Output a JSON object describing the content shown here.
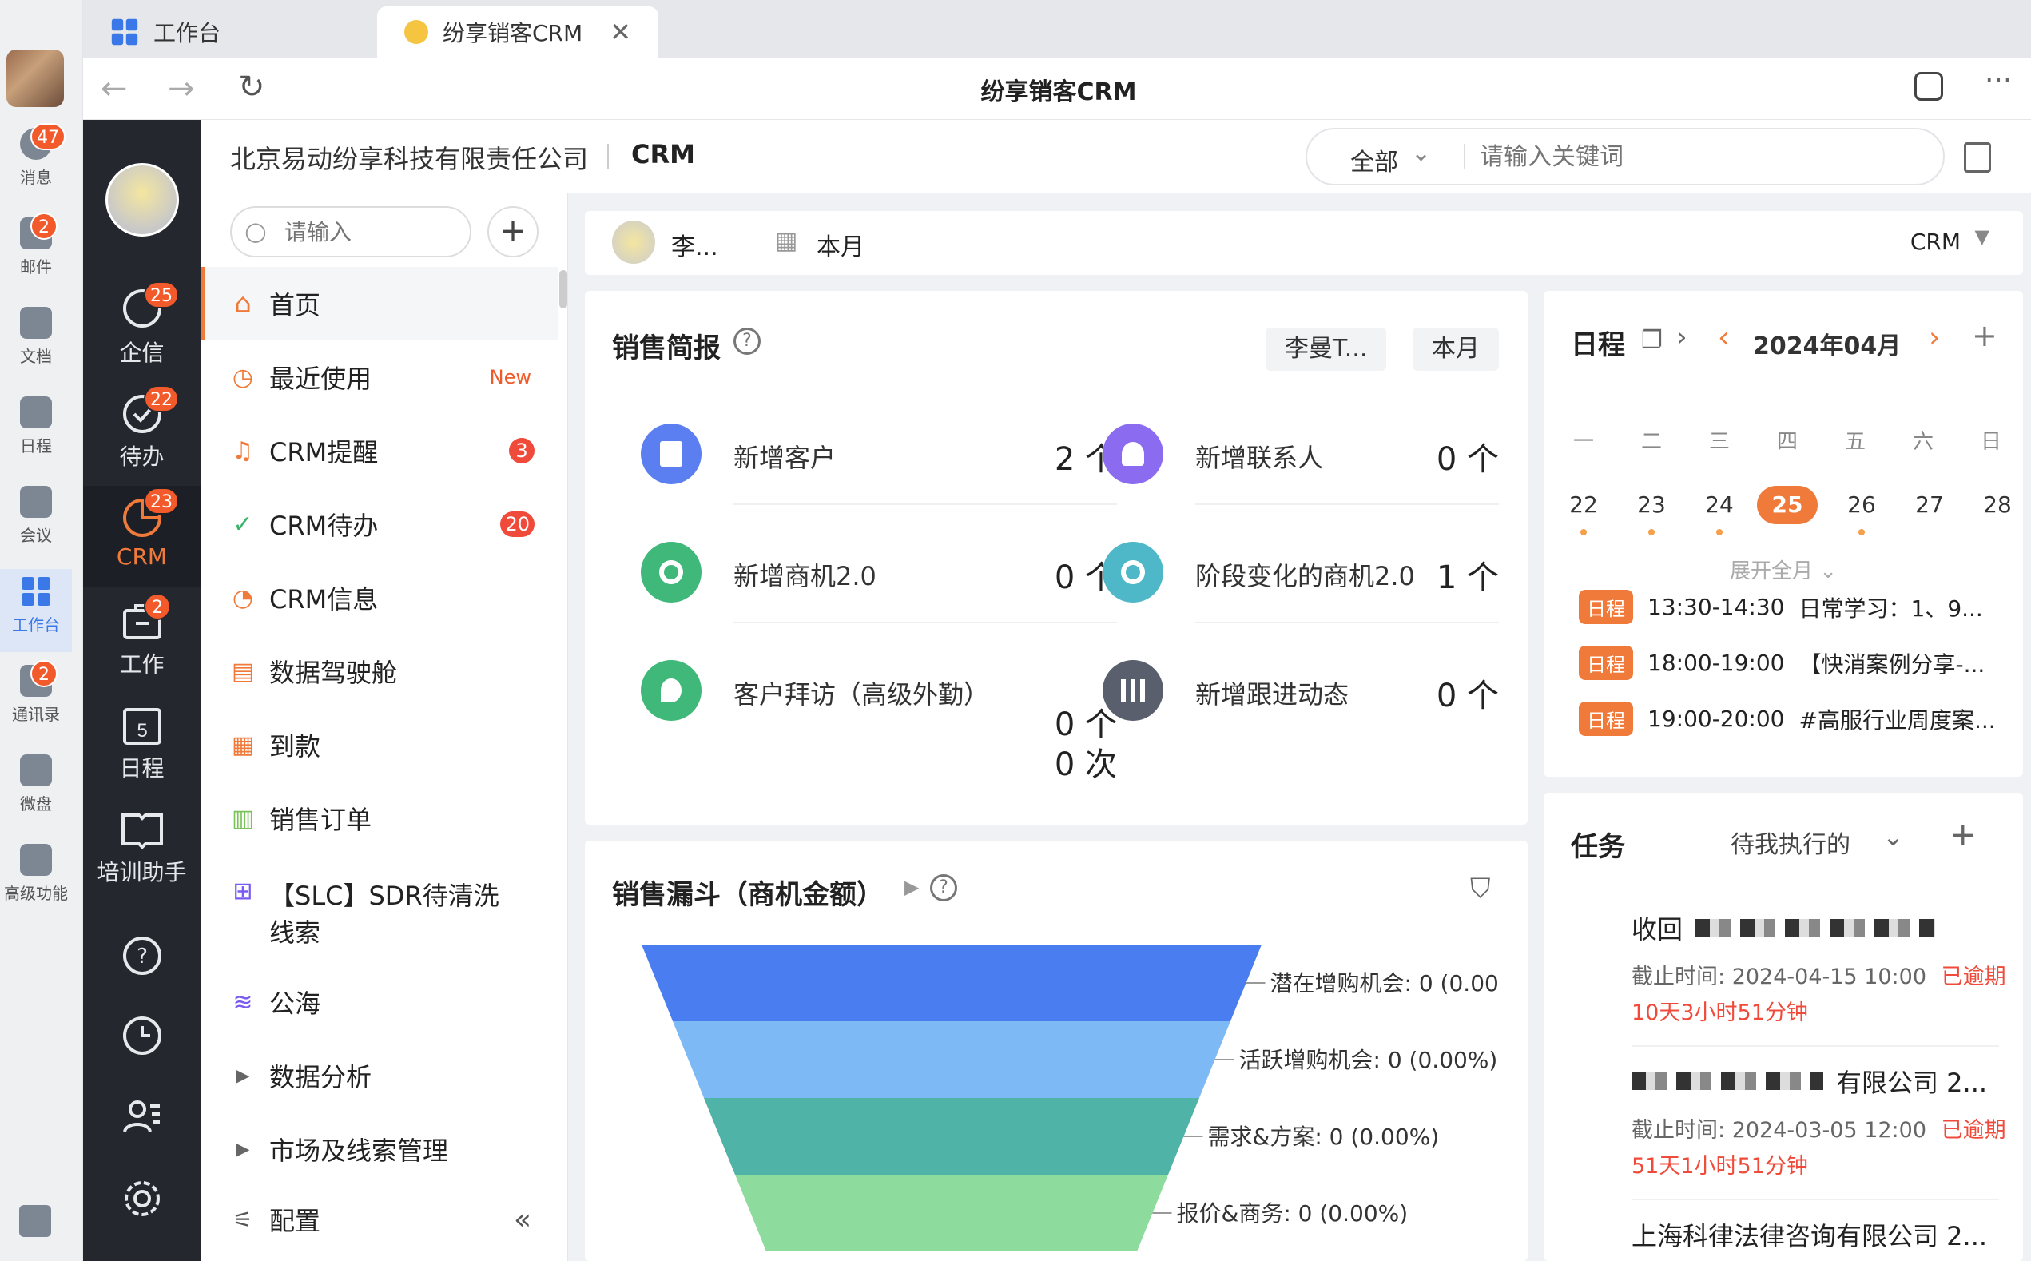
{
  "tabs": [
    {
      "label": "工作台",
      "active": false
    },
    {
      "label": "纷享销客CRM",
      "active": true
    }
  ],
  "window_title": "纷享销客CRM",
  "dock": [
    {
      "label": "消息",
      "badge": "47"
    },
    {
      "label": "邮件",
      "badge": "2"
    },
    {
      "label": "文档",
      "badge": ""
    },
    {
      "label": "日程",
      "badge": ""
    },
    {
      "label": "会议",
      "badge": ""
    },
    {
      "label": "工作台",
      "badge": ""
    },
    {
      "label": "通讯录",
      "badge": "2"
    },
    {
      "label": "微盘",
      "badge": ""
    },
    {
      "label": "高级功能",
      "badge": ""
    }
  ],
  "rail": [
    {
      "label": "企信",
      "badge": "25"
    },
    {
      "label": "待办",
      "badge": "22"
    },
    {
      "label": "CRM",
      "badge": "23"
    },
    {
      "label": "工作",
      "badge": "2"
    },
    {
      "label": "日程",
      "badge": "",
      "day": "5"
    },
    {
      "label": "培训助手",
      "badge": ""
    }
  ],
  "header": {
    "company": "北京易动纷享科技有限责任公司",
    "app": "CRM",
    "scope": "全部",
    "search_placeholder": "请输入关键词"
  },
  "menu": {
    "search_placeholder": "请输入",
    "items": [
      {
        "label": "首页",
        "badge": ""
      },
      {
        "label": "最近使用",
        "badge": "New"
      },
      {
        "label": "CRM提醒",
        "badge": "3"
      },
      {
        "label": "CRM待办",
        "badge": "20"
      },
      {
        "label": "CRM信息",
        "badge": ""
      },
      {
        "label": "数据驾驶舱",
        "badge": ""
      },
      {
        "label": "到款",
        "badge": ""
      },
      {
        "label": "销售订单",
        "badge": ""
      },
      {
        "label": "【SLC】SDR待清洗线索",
        "badge": ""
      },
      {
        "label": "公海",
        "badge": ""
      },
      {
        "label": "数据分析",
        "badge": ""
      },
      {
        "label": "市场及线索管理",
        "badge": ""
      },
      {
        "label": "配置",
        "badge": ""
      }
    ]
  },
  "filter": {
    "user": "李...",
    "period": "本月",
    "scope": "CRM"
  },
  "sales_brief": {
    "title": "销售简报",
    "user": "李曼T...",
    "period": "本月",
    "metrics": [
      {
        "label": "新增客户",
        "value": "2 个"
      },
      {
        "label": "新增联系人",
        "value": "0 个"
      },
      {
        "label": "新增商机2.0",
        "value": "0 个"
      },
      {
        "label": "阶段变化的商机2.0",
        "value": "1 个"
      },
      {
        "label": "客户拜访（高级外勤）",
        "value": "0 个",
        "value2": "0 次"
      },
      {
        "label": "新增跟进动态",
        "value": "0 个"
      }
    ]
  },
  "funnel": {
    "title": "销售漏斗（商机金额）",
    "stages": [
      {
        "label": "潜在增购机会: 0 (0.00",
        "color": "#4a7ef0"
      },
      {
        "label": "活跃增购机会: 0 (0.00%)",
        "color": "#7cb9f5"
      },
      {
        "label": "需求&方案: 0 (0.00%)",
        "color": "#4fb3a8"
      },
      {
        "label": "报价&商务: 0 (0.00%)",
        "color": "#8edb9e"
      }
    ]
  },
  "schedule": {
    "title": "日程",
    "month": "2024年04月",
    "weekdays": [
      "一",
      "二",
      "三",
      "四",
      "五",
      "六",
      "日"
    ],
    "days": [
      {
        "d": "22",
        "dot": true
      },
      {
        "d": "23",
        "dot": true
      },
      {
        "d": "24",
        "dot": true
      },
      {
        "d": "25",
        "dot": false,
        "today": true
      },
      {
        "d": "26",
        "dot": true
      },
      {
        "d": "27",
        "dot": false
      },
      {
        "d": "28",
        "dot": false
      }
    ],
    "expand": "展开全月",
    "events": [
      {
        "tag": "日程",
        "time": "13:30-14:30",
        "text": "日常学习：1、9..."
      },
      {
        "tag": "日程",
        "time": "18:00-19:00",
        "text": "【快消案例分享-..."
      },
      {
        "tag": "日程",
        "time": "19:00-20:00",
        "text": "#高服行业周度案..."
      }
    ]
  },
  "tasks": {
    "title": "任务",
    "filter": "待我执行的",
    "items": [
      {
        "title": "收回",
        "deadline_label": "截止时间:",
        "deadline": "2024-04-15 10:00",
        "status": "已逾期",
        "overdue": "10天3小时51分钟"
      },
      {
        "title": "有限公司 2...",
        "deadline_label": "截止时间:",
        "deadline": "2024-03-05 12:00",
        "status": "已逾期",
        "overdue": "51天1小时51分钟"
      },
      {
        "title": "上海科律法律咨询有限公司 2..."
      }
    ]
  }
}
